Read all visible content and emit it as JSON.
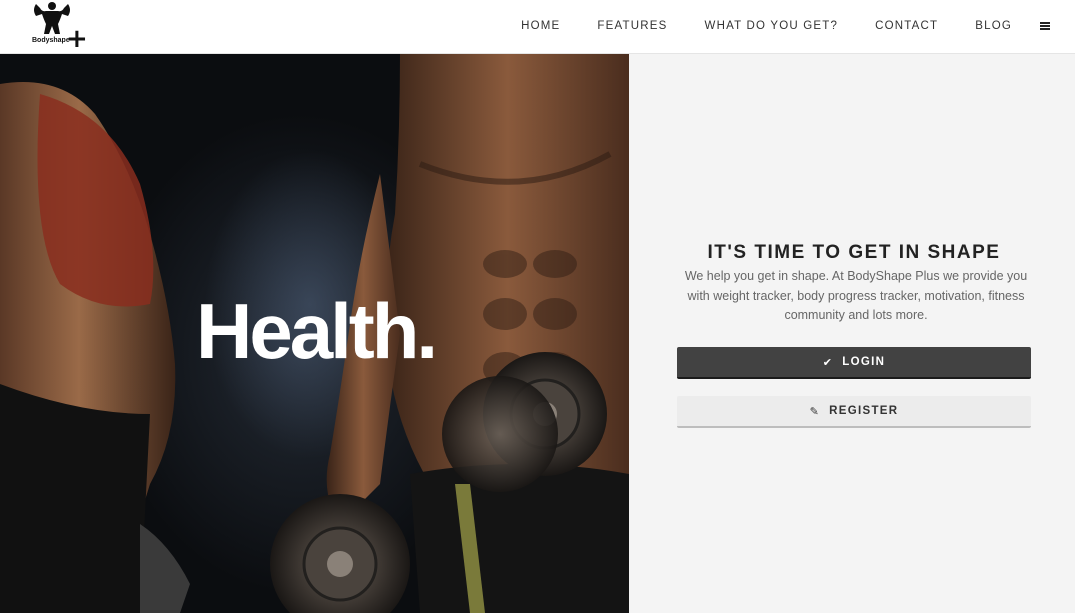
{
  "brand": {
    "logo_text": "Bodyshape",
    "logo_plus": "+"
  },
  "nav": {
    "items": [
      {
        "label": "HOME"
      },
      {
        "label": "FEATURES"
      },
      {
        "label": "WHAT DO YOU GET?"
      },
      {
        "label": "CONTACT"
      },
      {
        "label": "BLOG"
      }
    ],
    "menu_icon": "hamburger-icon"
  },
  "hero": {
    "title": "Health."
  },
  "panel": {
    "title": "IT'S TIME TO GET IN SHAPE",
    "description": "We help you get in shape. At BodyShape Plus we provide you with weight tracker, body progress tracker, motivation, fitness community and lots more.",
    "login": {
      "label": "LOGIN",
      "icon": "check-icon"
    },
    "register": {
      "label": "REGISTER",
      "icon": "pencil-icon"
    }
  },
  "colors": {
    "login_bg": "#424242",
    "register_bg": "#ececec",
    "panel_bg": "#f4f4f4"
  }
}
